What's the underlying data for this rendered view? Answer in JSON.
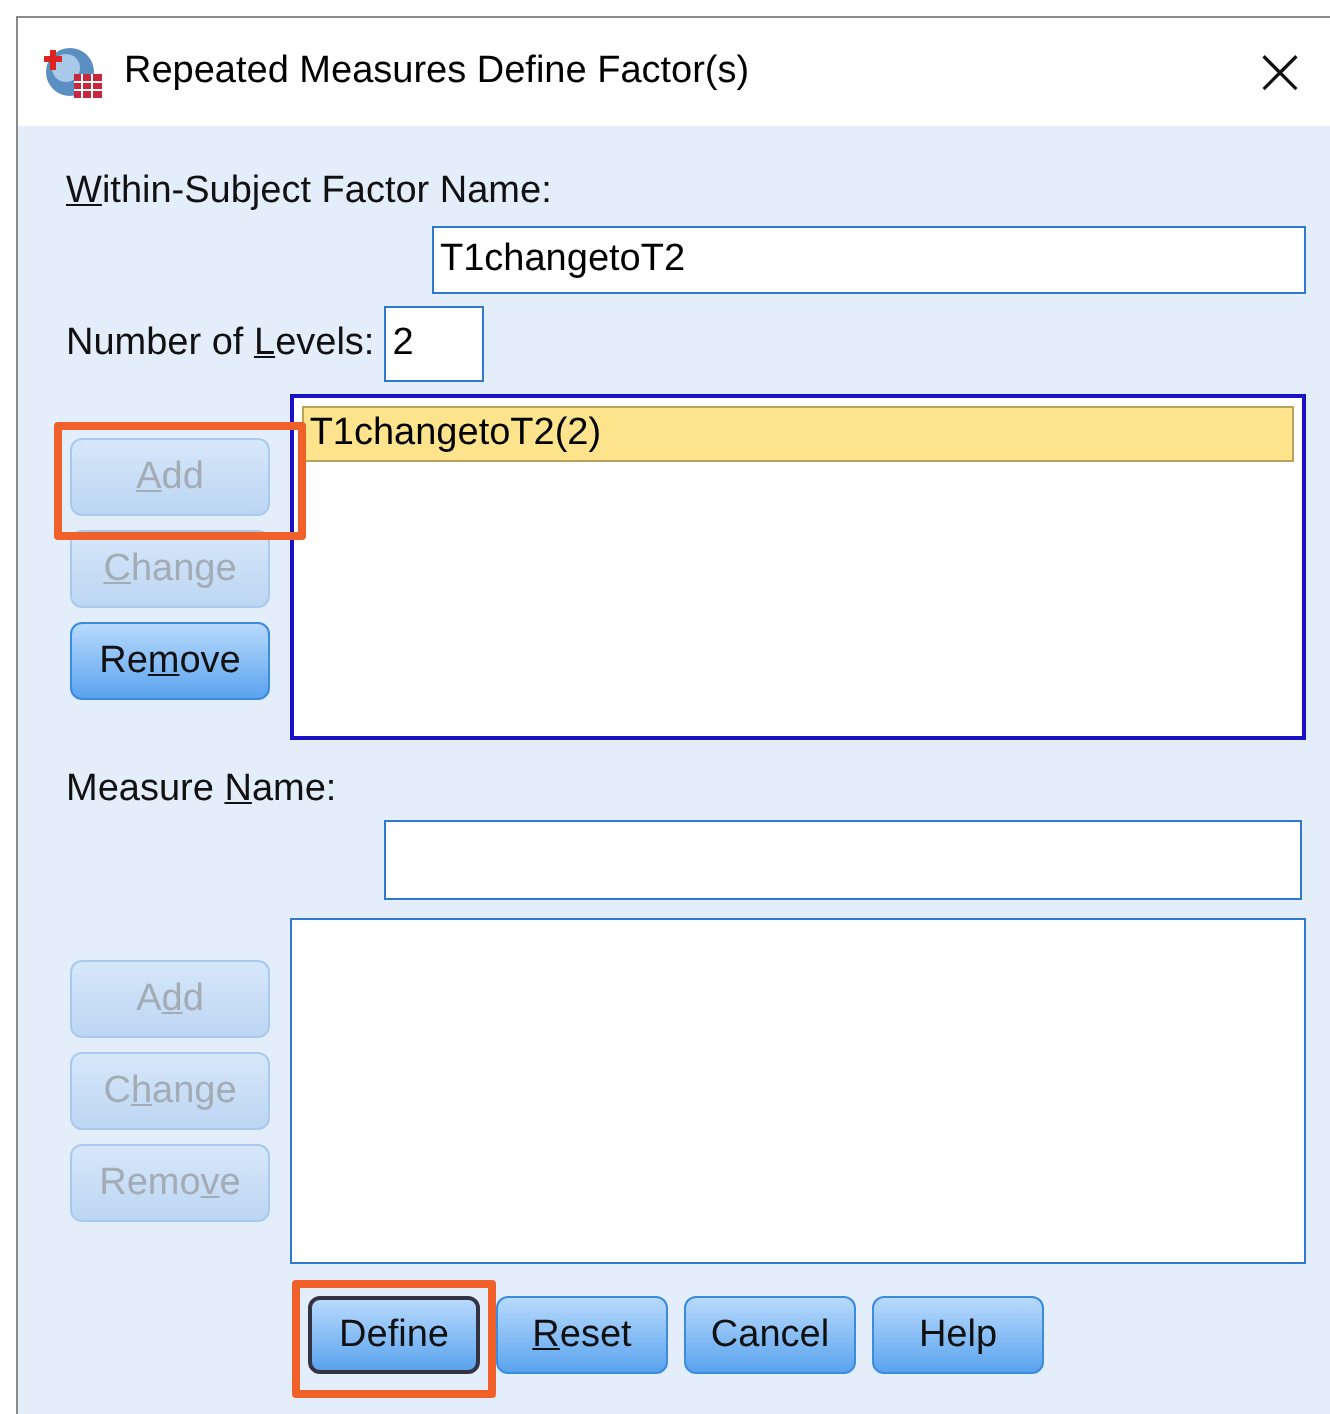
{
  "window": {
    "title": "Repeated Measures Define Factor(s)",
    "close": "×"
  },
  "factor_name": {
    "label": {
      "key": "W",
      "after": "ithin-Subject Factor Name:"
    },
    "value": "T1changetoT2"
  },
  "levels": {
    "label": {
      "before": "Number of ",
      "key": "L",
      "after": "evels:"
    },
    "value": "2"
  },
  "factor_list": {
    "items": [
      {
        "text": "T1changetoT2(2)",
        "selected": true
      }
    ],
    "buttons": [
      {
        "label": {
          "key": "A",
          "after": "dd"
        },
        "disabled": true,
        "highlighted": true
      },
      {
        "label": {
          "key": "C",
          "after": "hange"
        },
        "disabled": true,
        "highlighted": false
      },
      {
        "label": {
          "before": "Re",
          "key": "m",
          "after": "ove"
        },
        "disabled": false,
        "highlighted": false
      }
    ]
  },
  "measure_name": {
    "label": {
      "before": "Measure ",
      "key": "N",
      "after": "ame:"
    }
  },
  "measure_list": {
    "buttons": [
      {
        "label": {
          "before": "A",
          "key": "d",
          "after": "d"
        },
        "disabled": true,
        "highlighted": false
      },
      {
        "label": {
          "before": "C",
          "key": "h",
          "after": "ange"
        },
        "disabled": true,
        "highlighted": false
      },
      {
        "label": {
          "before": "Remo",
          "key": "v",
          "after": "e"
        },
        "disabled": true,
        "highlighted": false
      }
    ]
  },
  "footer_buttons": [
    {
      "label": {
        "before": "Define"
      },
      "focused": true,
      "highlighted": true
    },
    {
      "label": {
        "key": "R",
        "after": "eset"
      },
      "focused": false,
      "highlighted": false
    },
    {
      "label": {
        "before": "Cancel"
      },
      "focused": false,
      "highlighted": false
    },
    {
      "label": {
        "before": "Help"
      },
      "focused": false,
      "highlighted": false
    }
  ]
}
